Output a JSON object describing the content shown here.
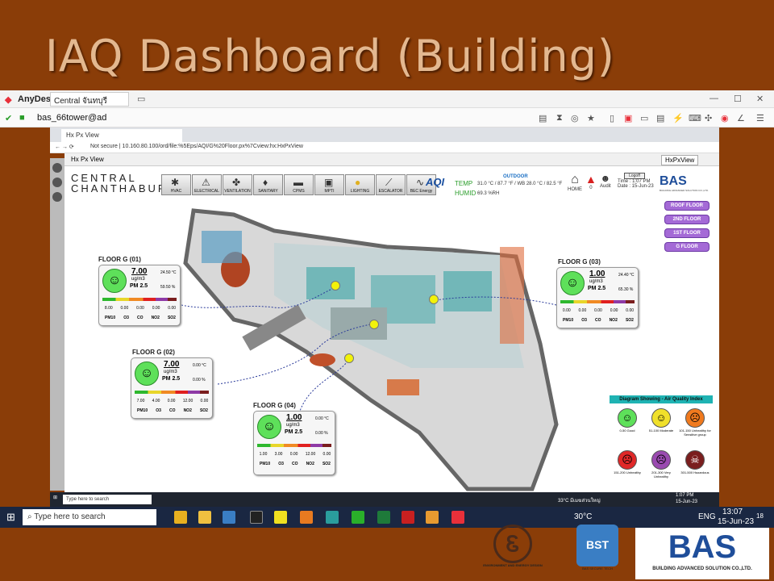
{
  "slide": {
    "title": "IAQ Dashboard (Building)"
  },
  "anydesk": {
    "brand": "AnyDesk",
    "tab": "Central จันทบุรี",
    "address": "bas_66tower@ad"
  },
  "browser": {
    "tab": "Hx Px View",
    "url": "Not secure  |  10.160.80.100/ord/file:%5Eps/AQI/G%20Floor.px%7Cview:hx:HxPxView",
    "hx": "Hx Px View",
    "hxright": "HxPxView"
  },
  "header": {
    "logo_line1": "CENTRAL",
    "logo_line2": "CHANTHABURI",
    "menu": [
      "HVAC",
      "ELECTRICAL",
      "VENTILATION",
      "SANITARY",
      "CPMS",
      "MPTI",
      "LIGHTING",
      "ESCALATOR",
      "BEC Energy"
    ],
    "aqi": "AQI",
    "temp_label": "TEMP",
    "humid_label": "HUMID",
    "outdoor": "OUTDOOR",
    "temp_value": "31.0 °C / 87.7 °F / WB 28.0 °C / 82.5 °F",
    "humid_value": "69.3 %RH",
    "home": "HOME",
    "alarm_count": "0",
    "audit": "Audit",
    "logoff": "Logoff",
    "time": "Time : 1:07 PM",
    "date": "Date : 15-Jun-23",
    "bas": "BAS",
    "bas_sub": "BUILDING ADVANCED SOLUTION CO.,LTD."
  },
  "floors": [
    "ROOF FLOOR",
    "2ND FLOOR",
    "1ST FLOOR",
    "G FLOOR"
  ],
  "cards": [
    {
      "label": "FLOOR G (01)",
      "aqi": "7.00",
      "unit": "ug/m3",
      "pm": "PM 2.5",
      "temp": "24.50 °C",
      "humid": "59.50 %",
      "values": [
        "8.00",
        "0.00",
        "0.00",
        "0.00",
        "0.00"
      ]
    },
    {
      "label": "FLOOR G (02)",
      "aqi": "7.00",
      "unit": "ug/m3",
      "pm": "PM 2.5",
      "temp": "0.00 °C",
      "humid": "0.00 %",
      "values": [
        "7.00",
        "4.00",
        "0.00",
        "12.00",
        "0.00"
      ]
    },
    {
      "label": "FLOOR G (03)",
      "aqi": "1.00",
      "unit": "ug/m3",
      "pm": "PM 2.5",
      "temp": "24.40 °C",
      "humid": "65.30 %",
      "values": [
        "0.00",
        "0.00",
        "0.00",
        "0.00",
        "0.00"
      ]
    },
    {
      "label": "FLOOR G (04)",
      "aqi": "1.00",
      "unit": "ug/m3",
      "pm": "PM 2.5",
      "temp": "0.00 °C",
      "humid": "0.00 %",
      "values": [
        "1.00",
        "3.00",
        "0.00",
        "12.00",
        "0.00"
      ]
    }
  ],
  "pollutants": [
    "PM10",
    "O3",
    "CO",
    "NO2",
    "SO2"
  ],
  "legend": {
    "title": "Diagram Showing - Air Quality Index",
    "items": [
      {
        "label": "0-50 Good",
        "color": "#5ee05a"
      },
      {
        "label": "51-100 Moderate",
        "color": "#f0e02a"
      },
      {
        "label": "101-150 Unhealthy for Sensitive group",
        "color": "#f07a1e"
      },
      {
        "label": "151-200 Unhealthy",
        "color": "#e02828"
      },
      {
        "label": "201-300 Very Unhealthy",
        "color": "#9a4ab0"
      },
      {
        "label": "301-500 Hazardous",
        "color": "#7a1e1e"
      }
    ]
  },
  "remote_taskbar": {
    "search": "Type here to search",
    "weather": "33°C มีเมฆส่วนใหญ่",
    "time": "1:07 PM",
    "date": "15-Jun-23"
  },
  "taskbar": {
    "search": "Type here to search",
    "temp": "30°C",
    "lang": "ENG",
    "time": "13:07",
    "date": "15-Jun-23",
    "badge": "18"
  },
  "logos": {
    "ee": "ENVIRONMENT AND ENERGY DESIGN",
    "bst": "BST",
    "bst_sub": "BAS SECURE TECH",
    "bas": "BAS",
    "bas_sub": "BUILDING ADVANCED SOLUTION CO.,LTD."
  }
}
